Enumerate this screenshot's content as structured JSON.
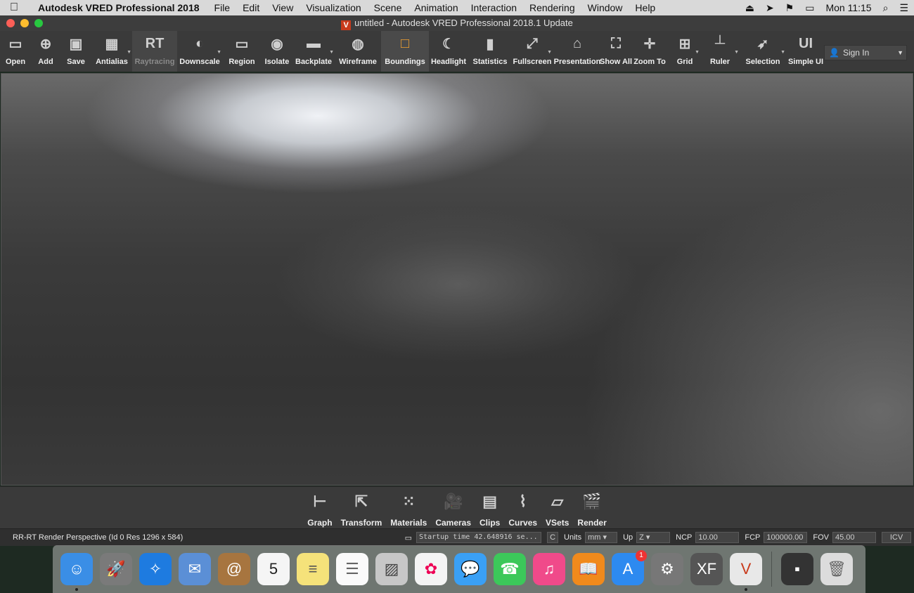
{
  "menubar": {
    "app": "Autodesk VRED Professional 2018",
    "items": [
      "File",
      "Edit",
      "View",
      "Visualization",
      "Scene",
      "Animation",
      "Interaction",
      "Rendering",
      "Window",
      "Help"
    ],
    "clock": "Mon 11:15"
  },
  "window": {
    "title": "untitled - Autodesk VRED Professional 2018.1 Update"
  },
  "toolbar": [
    {
      "id": "open",
      "label": "Open",
      "icon": "folder-icon",
      "glyph": "▭"
    },
    {
      "id": "add",
      "label": "Add",
      "icon": "add-file-icon",
      "glyph": "⊕"
    },
    {
      "id": "save",
      "label": "Save",
      "icon": "save-icon",
      "glyph": "▣"
    },
    {
      "id": "antialias",
      "label": "Antialias",
      "icon": "grid-dots-icon",
      "glyph": "▦",
      "caret": true
    },
    {
      "id": "raytracing",
      "label": "Raytracing",
      "icon": "raytracing-icon",
      "glyph": "RT",
      "dim": true
    },
    {
      "id": "downscale",
      "label": "Downscale",
      "icon": "half-circle-icon",
      "glyph": "◐",
      "caret": true
    },
    {
      "id": "region",
      "label": "Region",
      "icon": "region-icon",
      "glyph": "▭"
    },
    {
      "id": "isolate",
      "label": "Isolate",
      "icon": "eye-icon",
      "glyph": "◉"
    },
    {
      "id": "backplate",
      "label": "Backplate",
      "icon": "backplate-icon",
      "glyph": "▬",
      "caret": true
    },
    {
      "id": "wireframe",
      "label": "Wireframe",
      "icon": "globe-icon",
      "glyph": "◍"
    },
    {
      "id": "boundings",
      "label": "Boundings",
      "icon": "bounding-box-icon",
      "glyph": "□",
      "active": true
    },
    {
      "id": "headlight",
      "label": "Headlight",
      "icon": "headlight-icon",
      "glyph": "☾"
    },
    {
      "id": "statistics",
      "label": "Statistics",
      "icon": "bar-chart-icon",
      "glyph": "▮"
    },
    {
      "id": "fullscreen",
      "label": "Fullscreen",
      "icon": "expand-icon",
      "glyph": "⤢",
      "caret": true
    },
    {
      "id": "presentation",
      "label": "Presentation",
      "icon": "presentation-icon",
      "glyph": "⌂"
    },
    {
      "id": "showall",
      "label": "Show All",
      "icon": "show-all-icon",
      "glyph": "⛶"
    },
    {
      "id": "zoomto",
      "label": "Zoom To",
      "icon": "zoom-to-icon",
      "glyph": "✛"
    },
    {
      "id": "grid",
      "label": "Grid",
      "icon": "grid-icon",
      "glyph": "⊞",
      "caret": true
    },
    {
      "id": "ruler",
      "label": "Ruler",
      "icon": "ruler-icon",
      "glyph": "┴",
      "caret": true
    },
    {
      "id": "selection",
      "label": "Selection",
      "icon": "selection-icon",
      "glyph": "➶",
      "caret": true
    },
    {
      "id": "simpleui",
      "label": "Simple UI",
      "icon": "ui-icon",
      "glyph": "UI"
    }
  ],
  "signin": "Sign In",
  "modules": [
    {
      "label": "Graph",
      "icon": "graph-icon",
      "glyph": "⊢"
    },
    {
      "label": "Transform",
      "icon": "transform-icon",
      "glyph": "⇱"
    },
    {
      "label": "Materials",
      "icon": "materials-icon",
      "glyph": "⁙"
    },
    {
      "label": "Cameras",
      "icon": "camera-icon",
      "glyph": "🎥"
    },
    {
      "label": "Clips",
      "icon": "clips-icon",
      "glyph": "▤"
    },
    {
      "label": "Curves",
      "icon": "curves-icon",
      "glyph": "⌇"
    },
    {
      "label": "VSets",
      "icon": "vsets-icon",
      "glyph": "▱"
    },
    {
      "label": "Render",
      "icon": "clapper-icon",
      "glyph": "🎬"
    }
  ],
  "status": {
    "left": "RR-RT  Render Perspective (Id 0 Res 1296 x 584)",
    "log": "Startup time 42.648916 se...",
    "clear": "C",
    "units_label": "Units",
    "units": "mm",
    "up_label": "Up",
    "up": "Z",
    "ncp_label": "NCP",
    "ncp": "10.00",
    "fcp_label": "FCP",
    "fcp": "100000.00",
    "fov_label": "FOV",
    "fov": "45.00",
    "icv": "ICV"
  },
  "dock": [
    {
      "name": "finder-icon",
      "color": "#3a8ee6",
      "glyph": "☺",
      "dot": true
    },
    {
      "name": "launchpad-icon",
      "color": "#7a7a7a",
      "glyph": "🚀"
    },
    {
      "name": "safari-icon",
      "color": "#1e7be0",
      "glyph": "✧"
    },
    {
      "name": "mail-icon",
      "color": "#5b8fd6",
      "glyph": "✉"
    },
    {
      "name": "contacts-icon",
      "color": "#a7753f",
      "glyph": "@"
    },
    {
      "name": "calendar-icon",
      "color": "#f5f5f5",
      "glyph": "5",
      "text": "#222"
    },
    {
      "name": "notes-icon",
      "color": "#f5e27a",
      "glyph": "≡",
      "text": "#555"
    },
    {
      "name": "reminders-icon",
      "color": "#fafafa",
      "glyph": "☰",
      "text": "#666"
    },
    {
      "name": "preview-icon",
      "color": "#c7c7c7",
      "glyph": "▨",
      "text": "#444"
    },
    {
      "name": "photos-icon",
      "color": "#f4f4f4",
      "glyph": "✿",
      "text": "#e05"
    },
    {
      "name": "messages-icon",
      "color": "#3aa0f5",
      "glyph": "💬"
    },
    {
      "name": "facetime-icon",
      "color": "#3cc85a",
      "glyph": "☎"
    },
    {
      "name": "itunes-icon",
      "color": "#f04a8a",
      "glyph": "♫"
    },
    {
      "name": "ibooks-icon",
      "color": "#f08a1c",
      "glyph": "📖"
    },
    {
      "name": "app-store-icon",
      "color": "#2d8af0",
      "glyph": "A",
      "badge": "1"
    },
    {
      "name": "system-preferences-icon",
      "color": "#777",
      "glyph": "⚙"
    },
    {
      "name": "xf-icon",
      "color": "#555",
      "glyph": "XF"
    },
    {
      "name": "vred-pro-icon",
      "color": "#e8e8e8",
      "glyph": "V",
      "text": "#c83a1b",
      "dot": true
    },
    {
      "name": "screen-thumbnail-icon",
      "color": "#333",
      "glyph": "▪",
      "sep": true
    },
    {
      "name": "trash-icon",
      "color": "#dcdcdc",
      "glyph": "🗑",
      "text": "#666"
    }
  ]
}
